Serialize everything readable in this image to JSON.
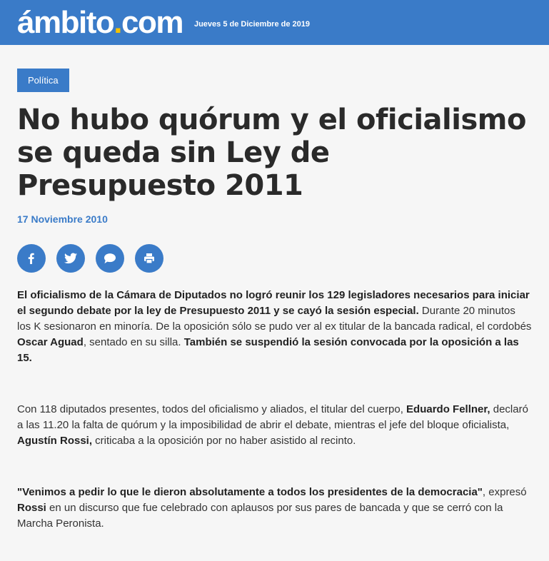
{
  "header": {
    "logo_main": "ámbito",
    "logo_dot": ".",
    "logo_tld": "com",
    "date": "Jueves 5 de Diciembre de 2019"
  },
  "article": {
    "section_tag": "Política",
    "title": "No hubo quórum y el oficialismo se queda sin Ley de Presupuesto 2011",
    "pub_date": "17 Noviembre 2010",
    "share": [
      {
        "icon": "facebook-icon"
      },
      {
        "icon": "twitter-icon"
      },
      {
        "icon": "comment-icon"
      },
      {
        "icon": "print-icon"
      }
    ],
    "p1": {
      "bold1": "El oficialismo de la Cámara de Diputados no logró reunir los 129 legisladores necesarios para iniciar el segundo debate por la ley de Presupuesto 2011 y se cayó la sesión especial.",
      "text1": " Durante 20 minutos los K sesionaron en minoría. De la oposición sólo se pudo ver al ex titular de la bancada radical, el cordobés ",
      "bold2": "Oscar Aguad",
      "text2": ", sentado en su silla. ",
      "bold3": "También se suspendió la sesión convocada por la oposición a las 15."
    },
    "p2": {
      "text1": "Con 118 diputados presentes, todos del oficialismo y aliados, el titular del cuerpo, ",
      "bold1": "Eduardo Fellner,",
      "text2": " declaró a las 11.20 la falta de quórum y la imposibilidad de abrir el debate, mientras el jefe del bloque oficialista, ",
      "bold2": "Agustín Rossi,",
      "text3": " criticaba a la oposición por no haber asistido al recinto."
    },
    "p3": {
      "bold1": "\"Venimos a pedir lo que le dieron absolutamente a todos los presidentes de la democracia\"",
      "text1": ", expresó ",
      "bold2": "Rossi",
      "text2": " en un discurso que fue celebrado con aplausos por sus pares de bancada y que se cerró con la Marcha Peronista."
    }
  },
  "colors": {
    "brand_blue": "#3a7bc8",
    "logo_dot": "#f5c100"
  }
}
